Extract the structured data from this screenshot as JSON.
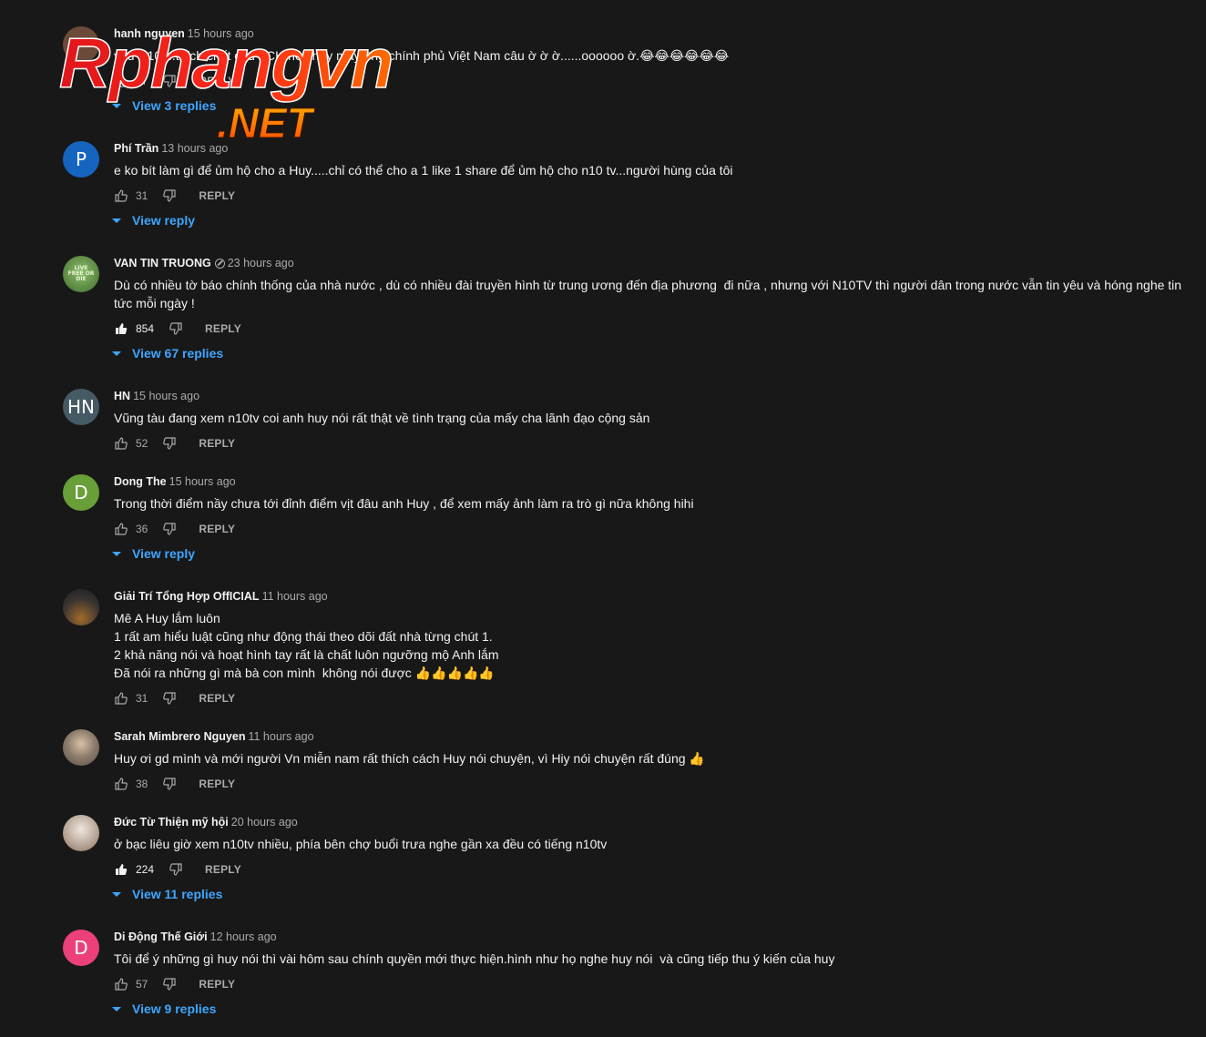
{
  "watermark": {
    "line1": "Rphangvn",
    "line2": ".NET"
  },
  "colors": {
    "background": "#181818",
    "accent_link": "#3ea6ff",
    "muted": "#aaaaaa"
  },
  "labels": {
    "reply": "REPLY"
  },
  "comments": [
    {
      "author": "hanh nguyen",
      "time": "15 hours ago",
      "avatar_letter": "",
      "avatar_color": "#6b4a3a",
      "text": "yeu N10 ...thích chất câu TCH nói thay mấy ông chính phủ Việt Nam câu ờ ờ ờ......oooooo ờ.😂😂😂😂😂😂",
      "likes": "57",
      "view_replies": "View 3 replies"
    },
    {
      "author": "Phí Trần",
      "time": "13 hours ago",
      "avatar_letter": "P",
      "avatar_color": "#1565c0",
      "text": "e ko bít làm gì để ủm hộ cho a Huy.....chỉ có thể cho a 1 like 1 share để ủm hộ cho n10 tv...người hùng của tôi",
      "likes": "31",
      "view_replies": "View reply"
    },
    {
      "author": "VAN TIN TRUONG",
      "time": "23 hours ago",
      "avatar_letter": "LIVE FREE OR DIE",
      "avatar_color": "#4f7a3a",
      "text": "Dù có nhiều tờ báo chính thống của nhà nước , dù có nhiều đài truyền hình từ trung ương đến địa phương  đi nữa , nhưng với N10TV thì người dân trong nước vẫn tin yêu và hóng nghe tin tức mỗi ngày !",
      "likes": "854",
      "view_replies": "View 67 replies"
    },
    {
      "author": "HN",
      "time": "15 hours ago",
      "avatar_letter": "HN",
      "avatar_color": "#455a64",
      "text": "Vũng tàu đang xem n10tv coi anh huy nói rất thật về tình trạng của mấy cha lãnh đạo cộng sản",
      "likes": "52",
      "view_replies": ""
    },
    {
      "author": "Dong The",
      "time": "15 hours ago",
      "avatar_letter": "D",
      "avatar_color": "#689f38",
      "text": "Trong thời điểm nầy chưa tới đỉnh điểm vịt đâu anh Huy , để xem mấy ảnh làm ra trò gì nữa không hihi",
      "likes": "36",
      "view_replies": "View reply"
    },
    {
      "author": "Giải Trí Tổng Hợp OffICIAL",
      "time": "11 hours ago",
      "avatar_letter": "",
      "avatar_color": "#3b3530",
      "text": "Mê A Huy lắm luôn\n1 rất am hiểu luật cũng như động thái theo dõi đất nhà từng chút 1.\n2 khả năng nói và hoạt hình tay rất là chất luôn ngưỡng mộ Anh lắm\nĐã nói ra những gì mà bà con mình  không nói được 👍👍👍👍👍",
      "likes": "31",
      "view_replies": ""
    },
    {
      "author": "Sarah Mimbrero Nguyen",
      "time": "11 hours ago",
      "avatar_letter": "",
      "avatar_color": "#8a7a6a",
      "text": "Huy ơi gd mình và mới người Vn miễn nam rất thích cách Huy nói chuyện, vì Hiy nói chuyện rất đúng 👍",
      "likes": "38",
      "view_replies": ""
    },
    {
      "author": "Đức Từ Thiện mỹ hội",
      "time": "20 hours ago",
      "avatar_letter": "",
      "avatar_color": "#b9a89a",
      "text": "ở bạc liêu giờ xem n10tv nhiều, phía bên chợ buổi trưa nghe gần xa đều có tiếng n10tv",
      "likes": "224",
      "view_replies": "View 11 replies"
    },
    {
      "author": "Di Động Thế Giới",
      "time": "12 hours ago",
      "avatar_letter": "D",
      "avatar_color": "#ec407a",
      "text": "Tôi để ý những gì huy nói thì vài hôm sau chính quyền mới thực hiện.hình như họ nghe huy nói  và cũng tiếp thu ý kiến của huy",
      "likes": "57",
      "view_replies": "View 9 replies"
    }
  ]
}
